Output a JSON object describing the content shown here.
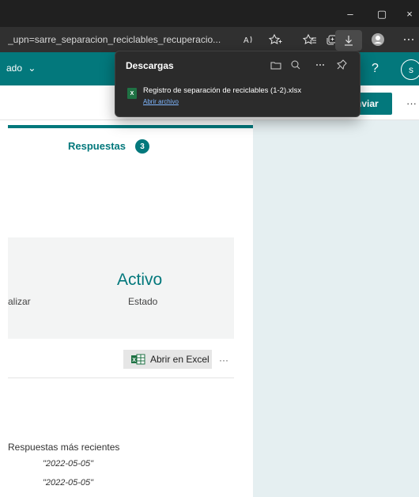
{
  "browser": {
    "url": "_upn=sarre_separacion_reciclables_recuperacio...",
    "window_controls": {
      "minimize": "–",
      "restore": "▢",
      "close": "×"
    },
    "toolbar_icons": [
      "read-aloud-icon",
      "favorite-add-icon",
      "favorites-icon",
      "collections-icon",
      "downloads-icon",
      "profile-icon",
      "more-icon"
    ]
  },
  "downloads": {
    "title": "Descargas",
    "file_name": "Registro de separación de reciclables (1-2).xlsx",
    "open_file_label": "Abrir archivo",
    "icons": [
      "folder-icon",
      "search-icon",
      "more-icon",
      "pin-icon"
    ]
  },
  "app": {
    "left_label": "ado",
    "help_label": "?",
    "avatar_label": "s",
    "send_label": "nviar",
    "more_label": "···"
  },
  "responses": {
    "tab_label": "Respuestas",
    "count": "3",
    "left_stat_label": "alizar",
    "status_value": "Activo",
    "status_label": "Estado",
    "open_excel_label": "Abrir en Excel",
    "more_label": "···",
    "recent_title": "Respuestas más recientes",
    "recent_items": [
      "\"2022-05-05\"",
      "\"2022-05-05\""
    ]
  },
  "colors": {
    "teal": "#03787c",
    "right_panel": "#e5eff1"
  }
}
